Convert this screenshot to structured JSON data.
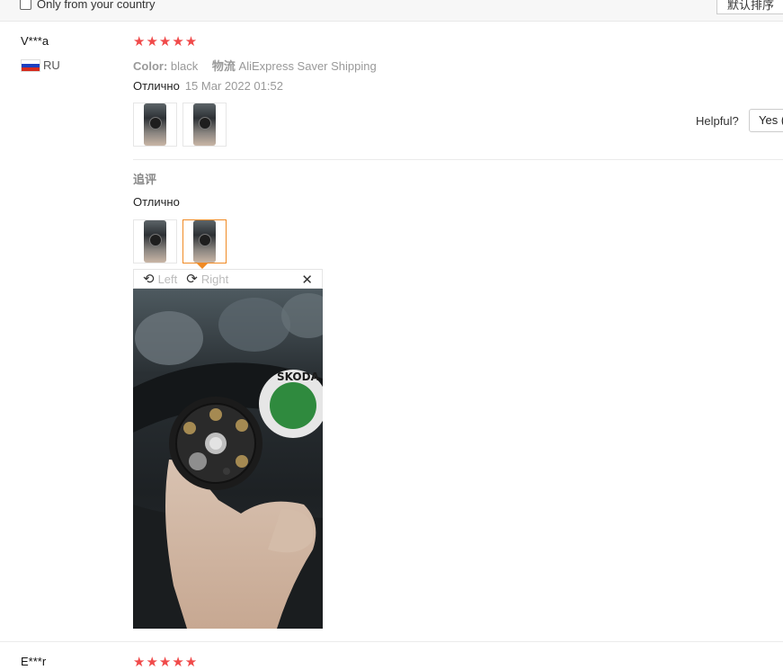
{
  "filters": {
    "only_country_label": "Only from your country",
    "sort_label": "默认排序"
  },
  "review1": {
    "user": "V***a",
    "country": "RU",
    "stars": "★★★★★",
    "color_label": "Color:",
    "color_value": "black",
    "shipping_label": "物流",
    "shipping_value": "AliExpress Saver Shipping",
    "text": "Отлично",
    "date": "15 Mar 2022 01:52",
    "helpful_label": "Helpful?",
    "yes_label": "Yes (",
    "followup_title": "追评",
    "followup_text": "Отлично"
  },
  "viewer": {
    "rotate_left": "Left",
    "rotate_right": "Right",
    "brand_text": "SKODA"
  },
  "review2": {
    "user": "E***r",
    "stars": "★★★★★"
  },
  "icons": {
    "rotate_left": "rotate-left-icon",
    "rotate_right": "rotate-right-icon",
    "close": "close-icon"
  },
  "colors": {
    "star": "#f04a4a",
    "accent": "#f08a24",
    "muted": "#999999"
  }
}
